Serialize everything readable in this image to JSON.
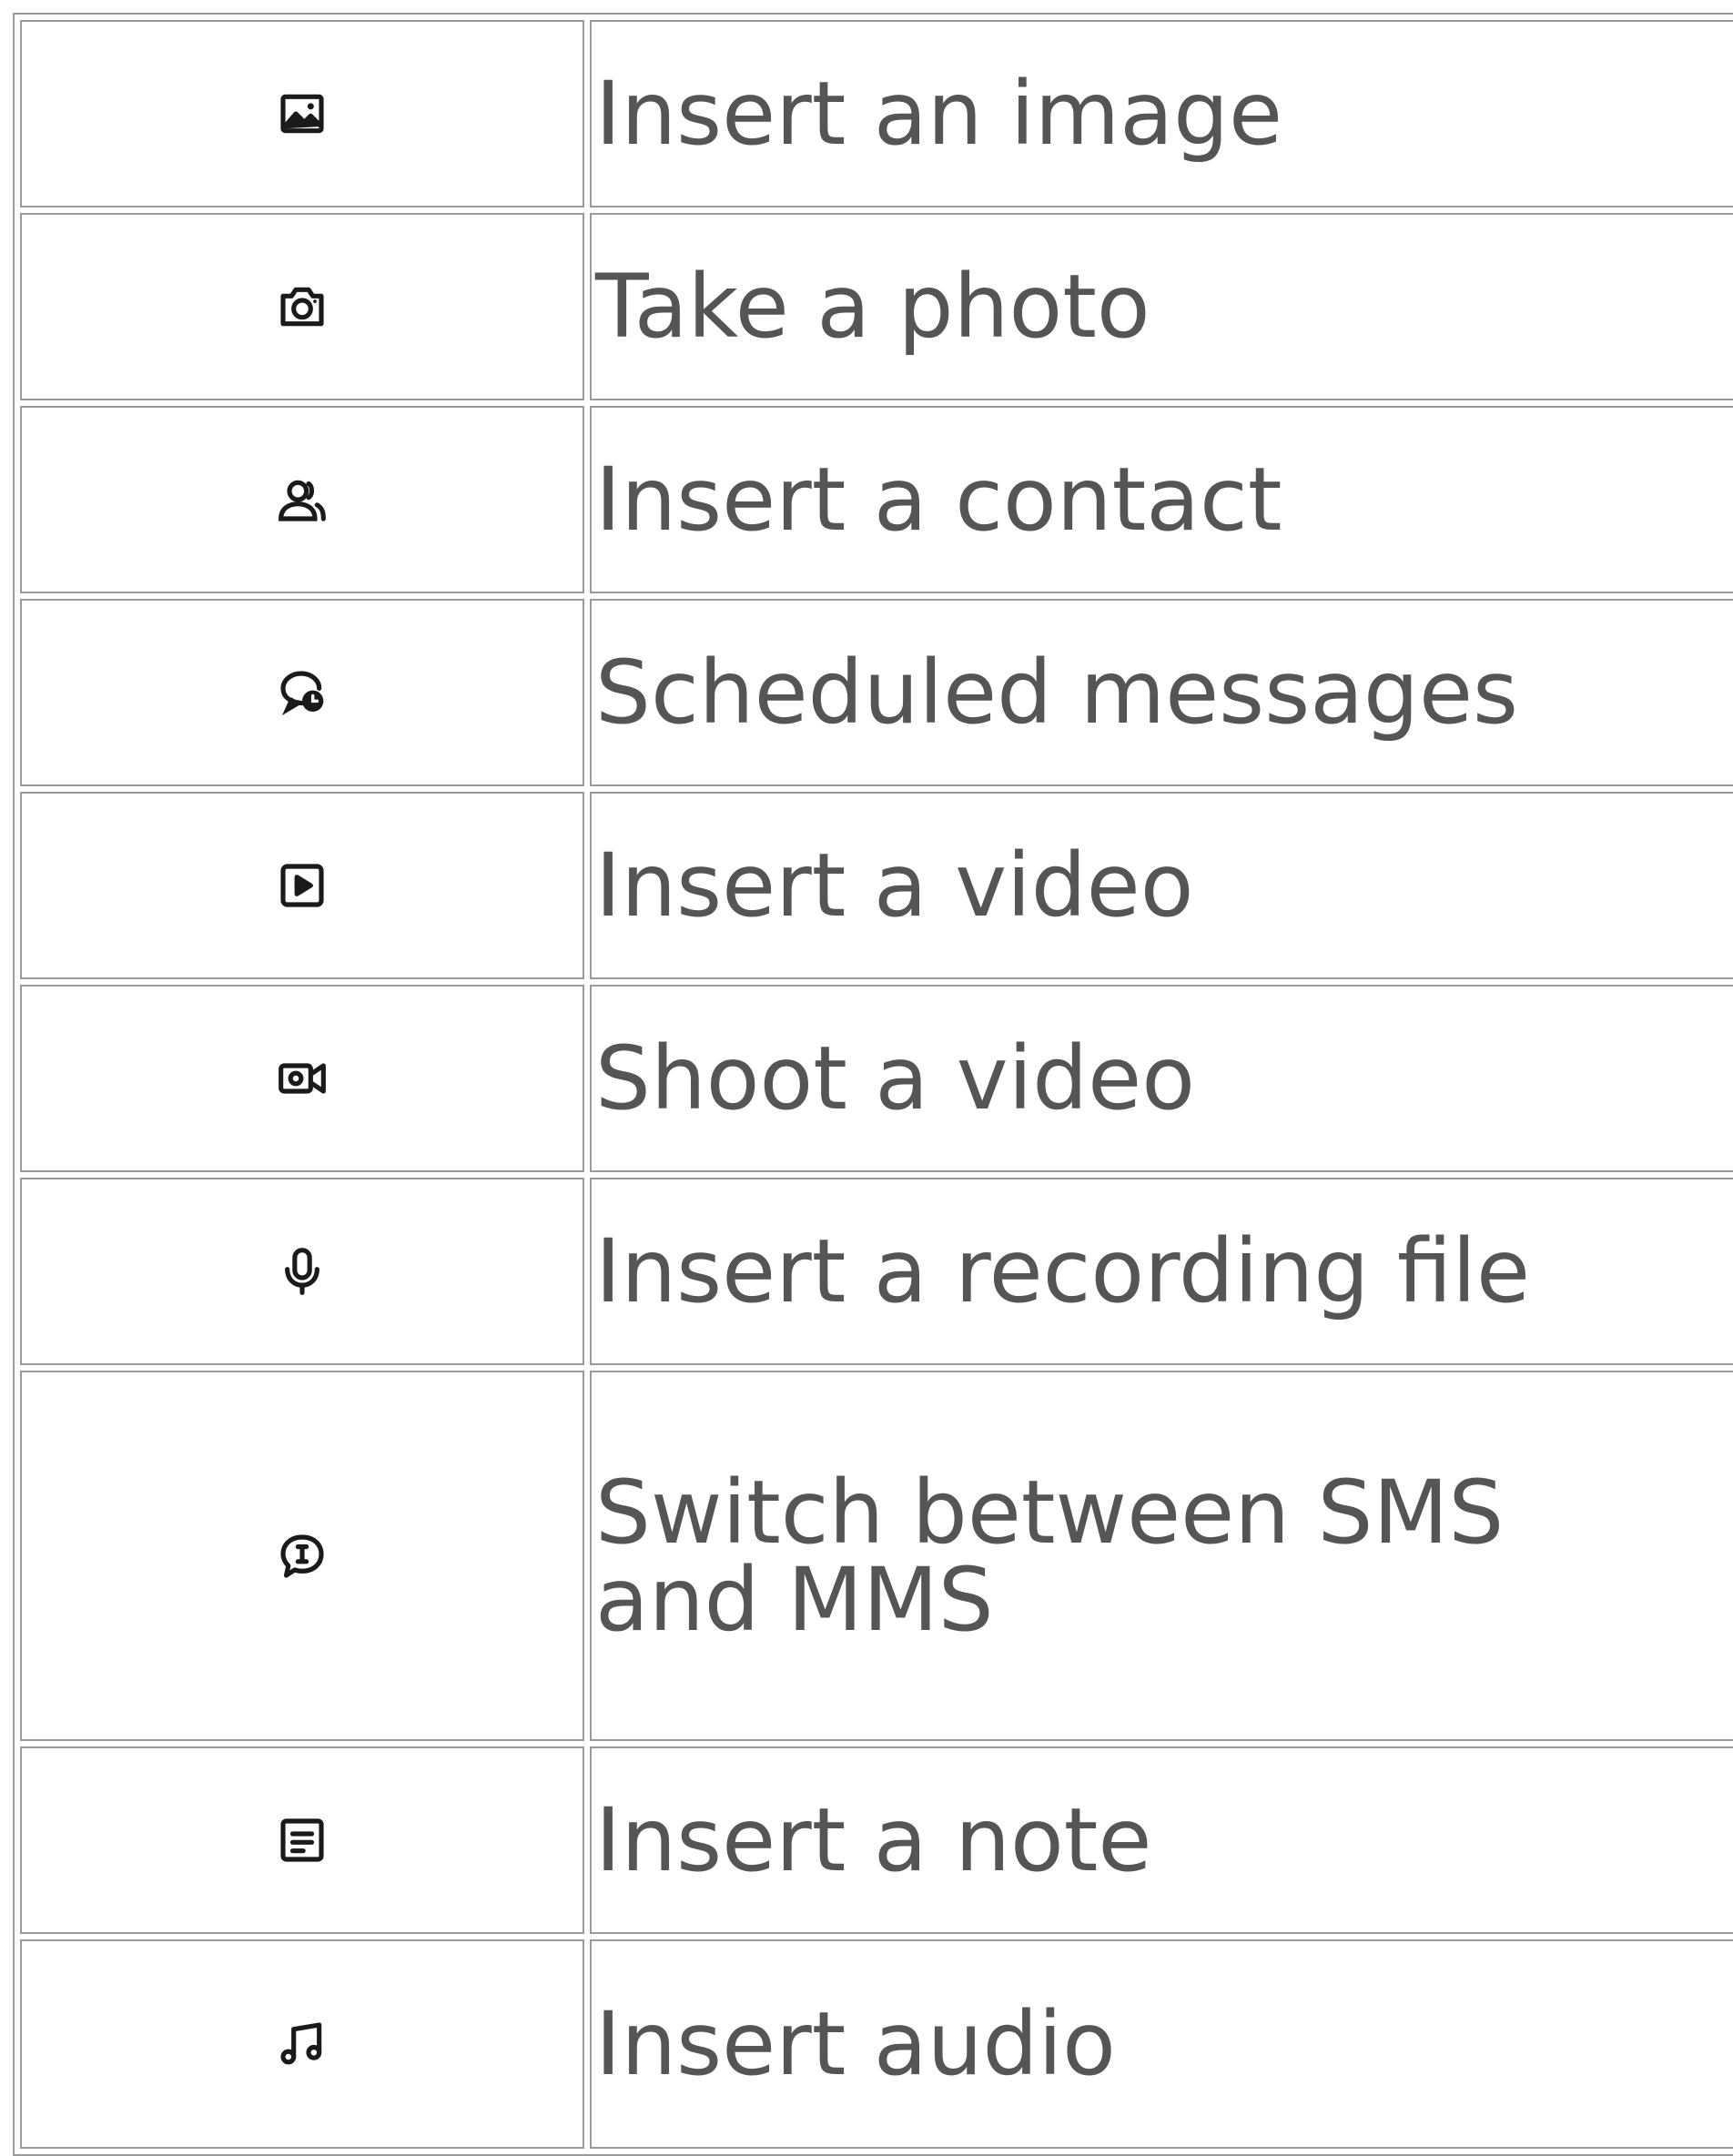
{
  "table": {
    "rows": [
      {
        "icon": "image-icon",
        "label": "Insert an image"
      },
      {
        "icon": "camera-icon",
        "label": "Take a photo"
      },
      {
        "icon": "contact-icon",
        "label": "Insert a contact"
      },
      {
        "icon": "scheduled-message-icon",
        "label": "Scheduled messages"
      },
      {
        "icon": "video-play-icon",
        "label": "Insert a video"
      },
      {
        "icon": "video-camera-icon",
        "label": "Shoot a video"
      },
      {
        "icon": "microphone-icon",
        "label": "Insert a recording file"
      },
      {
        "icon": "sms-mms-switch-icon",
        "label": "Switch between SMS and MMS"
      },
      {
        "icon": "note-icon",
        "label": "Insert a note"
      },
      {
        "icon": "music-note-icon",
        "label": "Insert audio"
      }
    ]
  },
  "colors": {
    "text": "#555555",
    "border": "#9a9a9a",
    "icon": "#1a1a1a"
  }
}
